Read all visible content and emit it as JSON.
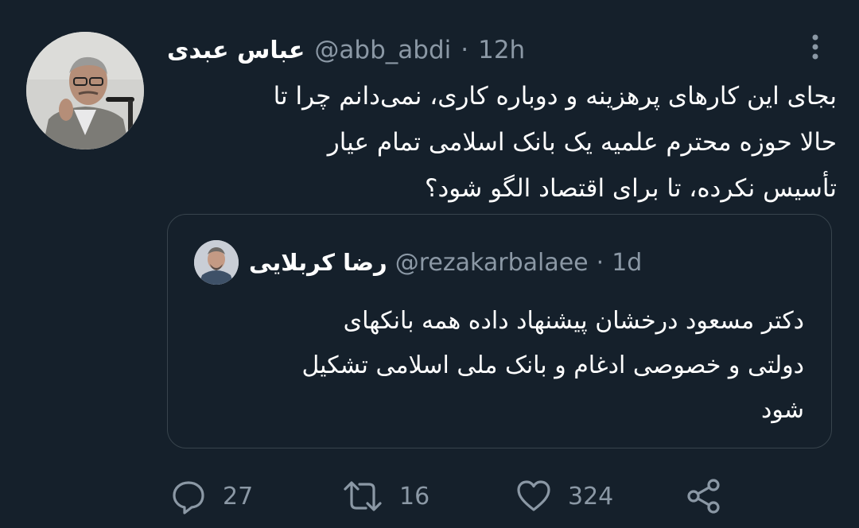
{
  "tweet": {
    "author_name": "عباس عبدی",
    "handle": "@abb_abdi",
    "separator": "·",
    "time": "12h",
    "text_lines": [
      "بجای این کارهای پرهزینه و دوباره کاری، نمی‌دانم چرا تا",
      "حالا حوزه محترم علمیه یک بانک اسلامی تمام عیار",
      "تأسیس نکرده، تا برای اقتصاد الگو شود؟"
    ]
  },
  "quoted_tweet": {
    "author_name": "رضا کربلایی",
    "handle": "@rezakarbalaee",
    "separator": "·",
    "time": "1d",
    "text_lines": [
      "دکتر مسعود درخشان پیشنهاد داده همه بانکهای",
      "دولتی و خصوصی ادغام و بانک ملی اسلامی تشکیل",
      "شود"
    ]
  },
  "actions": {
    "reply_count": "27",
    "retweet_count": "16",
    "like_count": "324"
  },
  "icons": {
    "more": "more-vertical-icon",
    "reply": "reply-icon",
    "retweet": "retweet-icon",
    "like": "heart-icon",
    "share": "share-icon"
  },
  "colors": {
    "background": "#15202b",
    "text_primary": "#ffffff",
    "text_secondary": "#8b98a5",
    "border": "#38444d"
  }
}
